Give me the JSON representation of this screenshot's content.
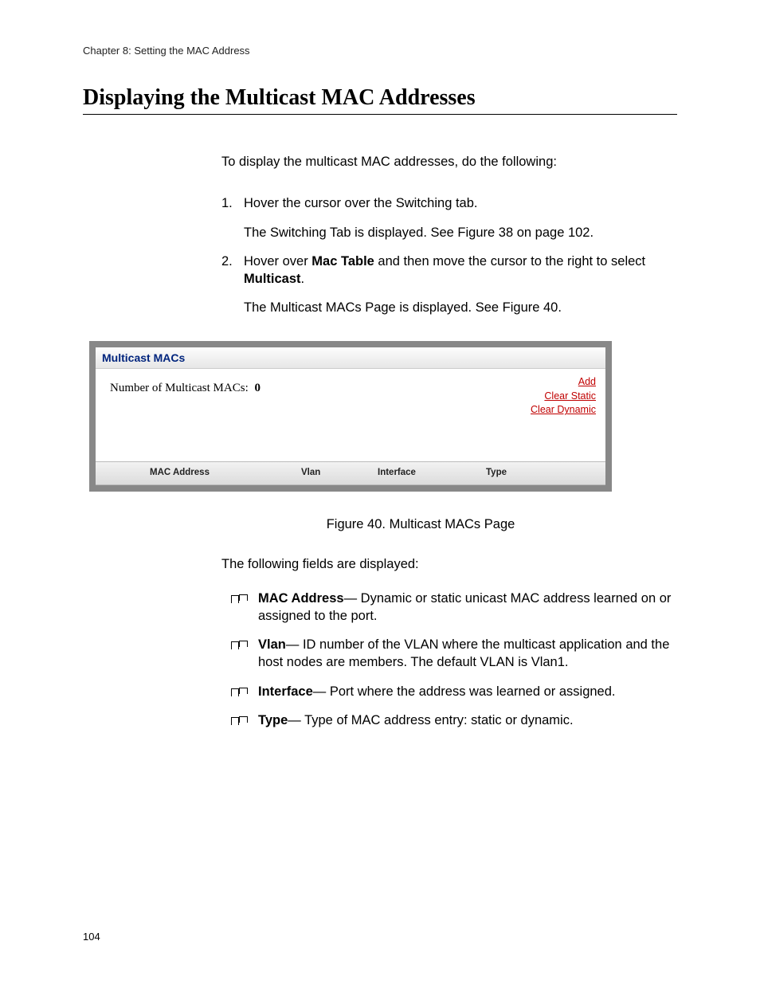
{
  "chapter_header": "Chapter 8: Setting the MAC Address",
  "title": "Displaying the Multicast MAC Addresses",
  "intro": "To display the multicast MAC addresses, do the following:",
  "steps": [
    {
      "num": "1.",
      "text": "Hover the cursor over the Switching tab.",
      "sub": "The Switching Tab is displayed. See Figure 38 on page 102."
    },
    {
      "num": "2.",
      "text_pre": "Hover over ",
      "text_bold1": "Mac Table",
      "text_mid": " and then move the cursor to the right to select ",
      "text_bold2": "Multicast",
      "text_post": ".",
      "sub": "The Multicast MACs Page is displayed. See Figure 40."
    }
  ],
  "panel": {
    "title": "Multicast MACs",
    "count_label": "Number of Multicast MACs:",
    "count_value": "0",
    "links": {
      "add": "Add",
      "clear_static": "Clear Static",
      "clear_dynamic": "Clear Dynamic"
    },
    "columns": {
      "mac": "MAC Address",
      "vlan": "Vlan",
      "interface": "Interface",
      "type": "Type"
    }
  },
  "figure_caption": "Figure 40. Multicast MACs Page",
  "fields_intro": "The following fields are displayed:",
  "fields": [
    {
      "term": "MAC Address",
      "desc": "— Dynamic or static unicast MAC address learned on or assigned to the port."
    },
    {
      "term": "Vlan",
      "desc": "— ID number of the VLAN where the multicast application and the host nodes are members. The default VLAN is Vlan1."
    },
    {
      "term": "Interface",
      "desc": "— Port where the address was learned or assigned."
    },
    {
      "term": "Type",
      "desc": "— Type of MAC address entry: static or dynamic."
    }
  ],
  "page_number": "104"
}
